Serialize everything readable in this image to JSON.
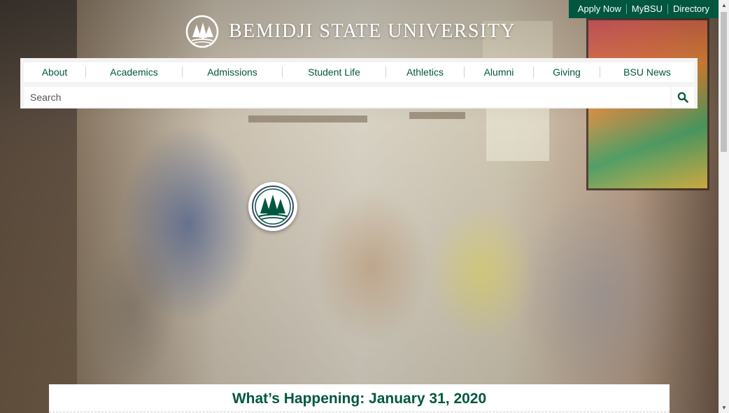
{
  "utility_nav": {
    "apply_now": "Apply Now",
    "mybsu": "MyBSU",
    "directory": "Directory"
  },
  "brand": {
    "name": "BEMIDJI STATE UNIVERSITY"
  },
  "main_nav": {
    "items": [
      {
        "label": "About"
      },
      {
        "label": "Academics"
      },
      {
        "label": "Admissions"
      },
      {
        "label": "Student Life"
      },
      {
        "label": "Athletics"
      },
      {
        "label": "Alumni"
      },
      {
        "label": "Giving"
      },
      {
        "label": "BSU News"
      }
    ]
  },
  "search": {
    "placeholder": "Search",
    "value": ""
  },
  "hero": {
    "icon": "bsu-pine-trees-seal"
  },
  "feature": {
    "heading": "What’s Happening: January 31, 2020"
  },
  "colors": {
    "brand_green": "#00573f",
    "white": "#ffffff"
  },
  "scrollbar": {
    "position": 0.0
  }
}
